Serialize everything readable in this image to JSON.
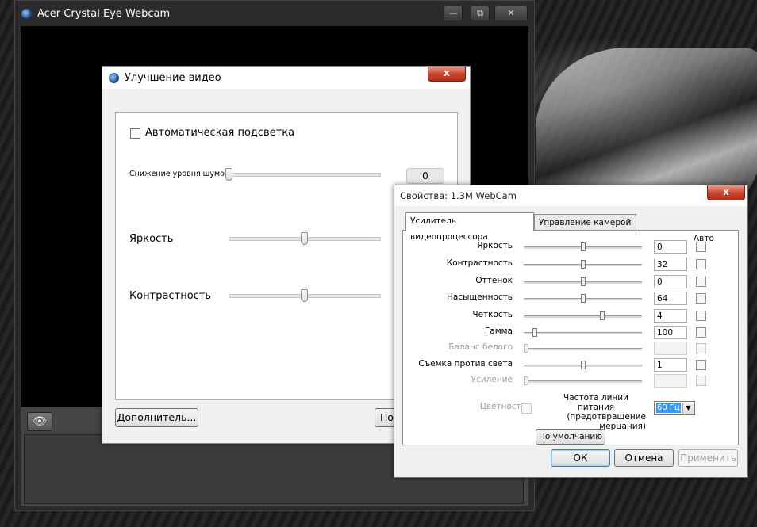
{
  "camera_window": {
    "title": "Acer Crystal Eye Webcam",
    "controls": {
      "minimize": "—",
      "restore": "⧉",
      "close": "✕"
    },
    "eye_button_icon": "eye-icon"
  },
  "video_dialog": {
    "title": "Улучшение видео",
    "auto_backlight_label": "Автоматическая подсветка",
    "auto_backlight_checked": false,
    "noise_label": "Снижение уровня шумов",
    "noise_value": "0",
    "noise_level": 0,
    "brightness_label": "Яркость",
    "brightness_level": 0.5,
    "contrast_label": "Контрастность",
    "contrast_level": 0.5,
    "advanced_button": "Дополнитель...",
    "partial_button": "По",
    "close_symbol": "x"
  },
  "properties_dialog": {
    "title": "Свойства: 1.3M WebCam",
    "close_symbol": "x",
    "tabs": [
      "Усилитель видеопроцессора",
      "Управление камерой"
    ],
    "active_tab": 0,
    "auto_header": "Авто",
    "rows": [
      {
        "label": "Яркость",
        "value": "0",
        "level": 0.5,
        "disabled": false
      },
      {
        "label": "Контрастность",
        "value": "32",
        "level": 0.5,
        "disabled": false
      },
      {
        "label": "Оттенок",
        "value": "0",
        "level": 0.5,
        "disabled": false
      },
      {
        "label": "Насыщенность",
        "value": "64",
        "level": 0.5,
        "disabled": false
      },
      {
        "label": "Четкость",
        "value": "4",
        "level": 0.67,
        "disabled": false
      },
      {
        "label": "Гамма",
        "value": "100",
        "level": 0.08,
        "disabled": false
      },
      {
        "label": "Баланс белого",
        "value": "",
        "level": 0.0,
        "disabled": true
      },
      {
        "label": "Съемка против света",
        "value": "1",
        "level": 0.5,
        "disabled": false
      },
      {
        "label": "Усиление",
        "value": "",
        "level": 0.0,
        "disabled": true
      }
    ],
    "color_label": "Цветность",
    "power_freq_label_1": "Частота линии питания",
    "power_freq_label_2": "(предотвращение",
    "power_freq_label_3": "мерцания)",
    "power_freq_value": "60 Гц",
    "default_button": "По умолчанию",
    "ok_button": "ОК",
    "cancel_button": "Отмена",
    "apply_button": "Применить"
  }
}
